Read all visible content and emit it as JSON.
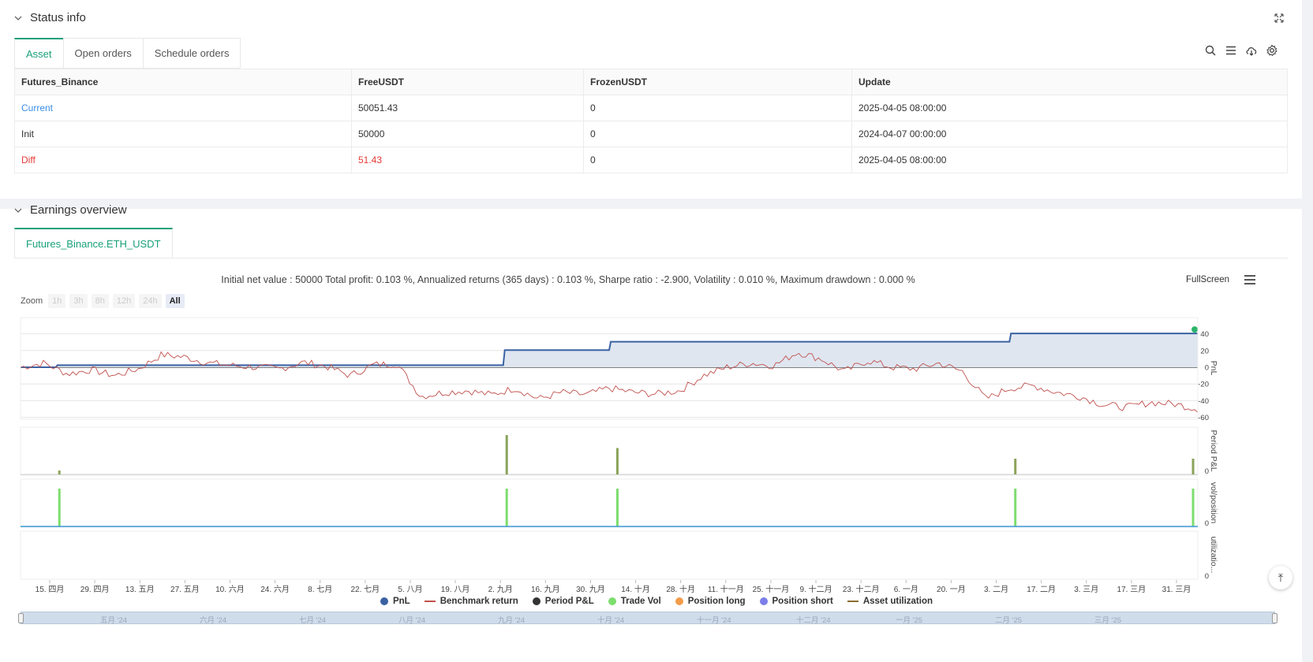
{
  "status": {
    "title": "Status info",
    "tabs": [
      "Asset",
      "Open orders",
      "Schedule orders"
    ],
    "table": {
      "headers": [
        "Futures_Binance",
        "FreeUSDT",
        "FrozenUSDT",
        "Update"
      ],
      "rows": [
        [
          "Current",
          "50051.43",
          "0",
          "2025-04-05 08:00:00"
        ],
        [
          "Init",
          "50000",
          "0",
          "2024-04-07 00:00:00"
        ],
        [
          "Diff",
          "51.43",
          "0",
          "2025-04-05 08:00:00"
        ]
      ]
    }
  },
  "earnings": {
    "title": "Earnings overview",
    "tab": "Futures_Binance.ETH_USDT",
    "summary": "Initial net value : 50000 Total profit: 0.103 %, Annualized returns (365 days) : 0.103 %, Sharpe ratio : -2.900, Volatility : 0.010 %, Maximum drawdown : 0.000 %",
    "fullscreen": "FullScreen",
    "zoom_label": "Zoom",
    "zoom_buttons": [
      "1h",
      "3h",
      "8h",
      "12h",
      "24h",
      "All"
    ]
  },
  "chart_data": {
    "type": "line",
    "x_labels": [
      "15. 四月",
      "29. 四月",
      "13. 五月",
      "27. 五月",
      "10. 六月",
      "24. 六月",
      "8. 七月",
      "22. 七月",
      "5. 八月",
      "19. 八月",
      "2. 九月",
      "16. 九月",
      "30. 九月",
      "14. 十月",
      "28. 十月",
      "11. 十一月",
      "25. 十一月",
      "9. 十二月",
      "23. 十二月",
      "6. 一月",
      "20. 一月",
      "3. 二月",
      "17. 二月",
      "3. 三月",
      "17. 三月",
      "31. 三月"
    ],
    "pnl_axis": {
      "label": "PnL",
      "ticks": [
        40,
        20,
        0,
        -20,
        -40,
        -60
      ]
    },
    "pnl_steps": [
      [
        0,
        0
      ],
      [
        3,
        2.5
      ],
      [
        41,
        20.5
      ],
      [
        50,
        30.5
      ],
      [
        84,
        40.5
      ],
      [
        99,
        40.5
      ]
    ],
    "benchmark_path": [
      0,
      5,
      -8,
      -3,
      -10,
      -2,
      15,
      12,
      5,
      2,
      0,
      -2,
      6,
      1,
      -10,
      3,
      4,
      -35,
      -30,
      -28,
      -33,
      -25,
      -38,
      -30,
      -33,
      -25,
      -30,
      -32,
      -28,
      -10,
      0,
      5,
      2,
      18,
      10,
      -5,
      8,
      0,
      -2,
      5,
      -5,
      -38,
      -25,
      -22,
      -30,
      -35,
      -45,
      -48,
      -42,
      -44,
      -50
    ],
    "period_pnl": {
      "label": "Period P&L",
      "tick": "0",
      "bars": [
        [
          3.3,
          0.1
        ],
        [
          41.3,
          1.0
        ],
        [
          50.7,
          0.67
        ],
        [
          84.5,
          0.4
        ],
        [
          99.6,
          0.4
        ]
      ]
    },
    "vol_position": {
      "label": "vol/position",
      "tick": "0",
      "bars": [
        [
          3.3,
          1
        ],
        [
          41.3,
          1
        ],
        [
          50.7,
          1
        ],
        [
          84.5,
          1
        ],
        [
          99.6,
          1
        ]
      ]
    },
    "utilization": {
      "label": "utilizatio...",
      "tick": "0"
    },
    "legend": [
      {
        "name": "PnL",
        "kind": "dot",
        "color": "#3a62a3"
      },
      {
        "name": "Benchmark return",
        "kind": "line",
        "color": "#c0504d"
      },
      {
        "name": "Period P&L",
        "kind": "dot",
        "color": "#333333"
      },
      {
        "name": "Trade Vol",
        "kind": "dot",
        "color": "#7ddd6e"
      },
      {
        "name": "Position long",
        "kind": "dot",
        "color": "#f39c4a"
      },
      {
        "name": "Position short",
        "kind": "dot",
        "color": "#7b7ee8"
      },
      {
        "name": "Asset utilization",
        "kind": "line",
        "color": "#8a6d2f"
      }
    ],
    "navigator_labels": [
      "五月 '24",
      "六月 '24",
      "七月 '24",
      "八月 '24",
      "九月 '24",
      "十月 '24",
      "十一月 '24",
      "十二月 '24",
      "一月 '25",
      "二月 '25",
      "三月 '25"
    ]
  }
}
